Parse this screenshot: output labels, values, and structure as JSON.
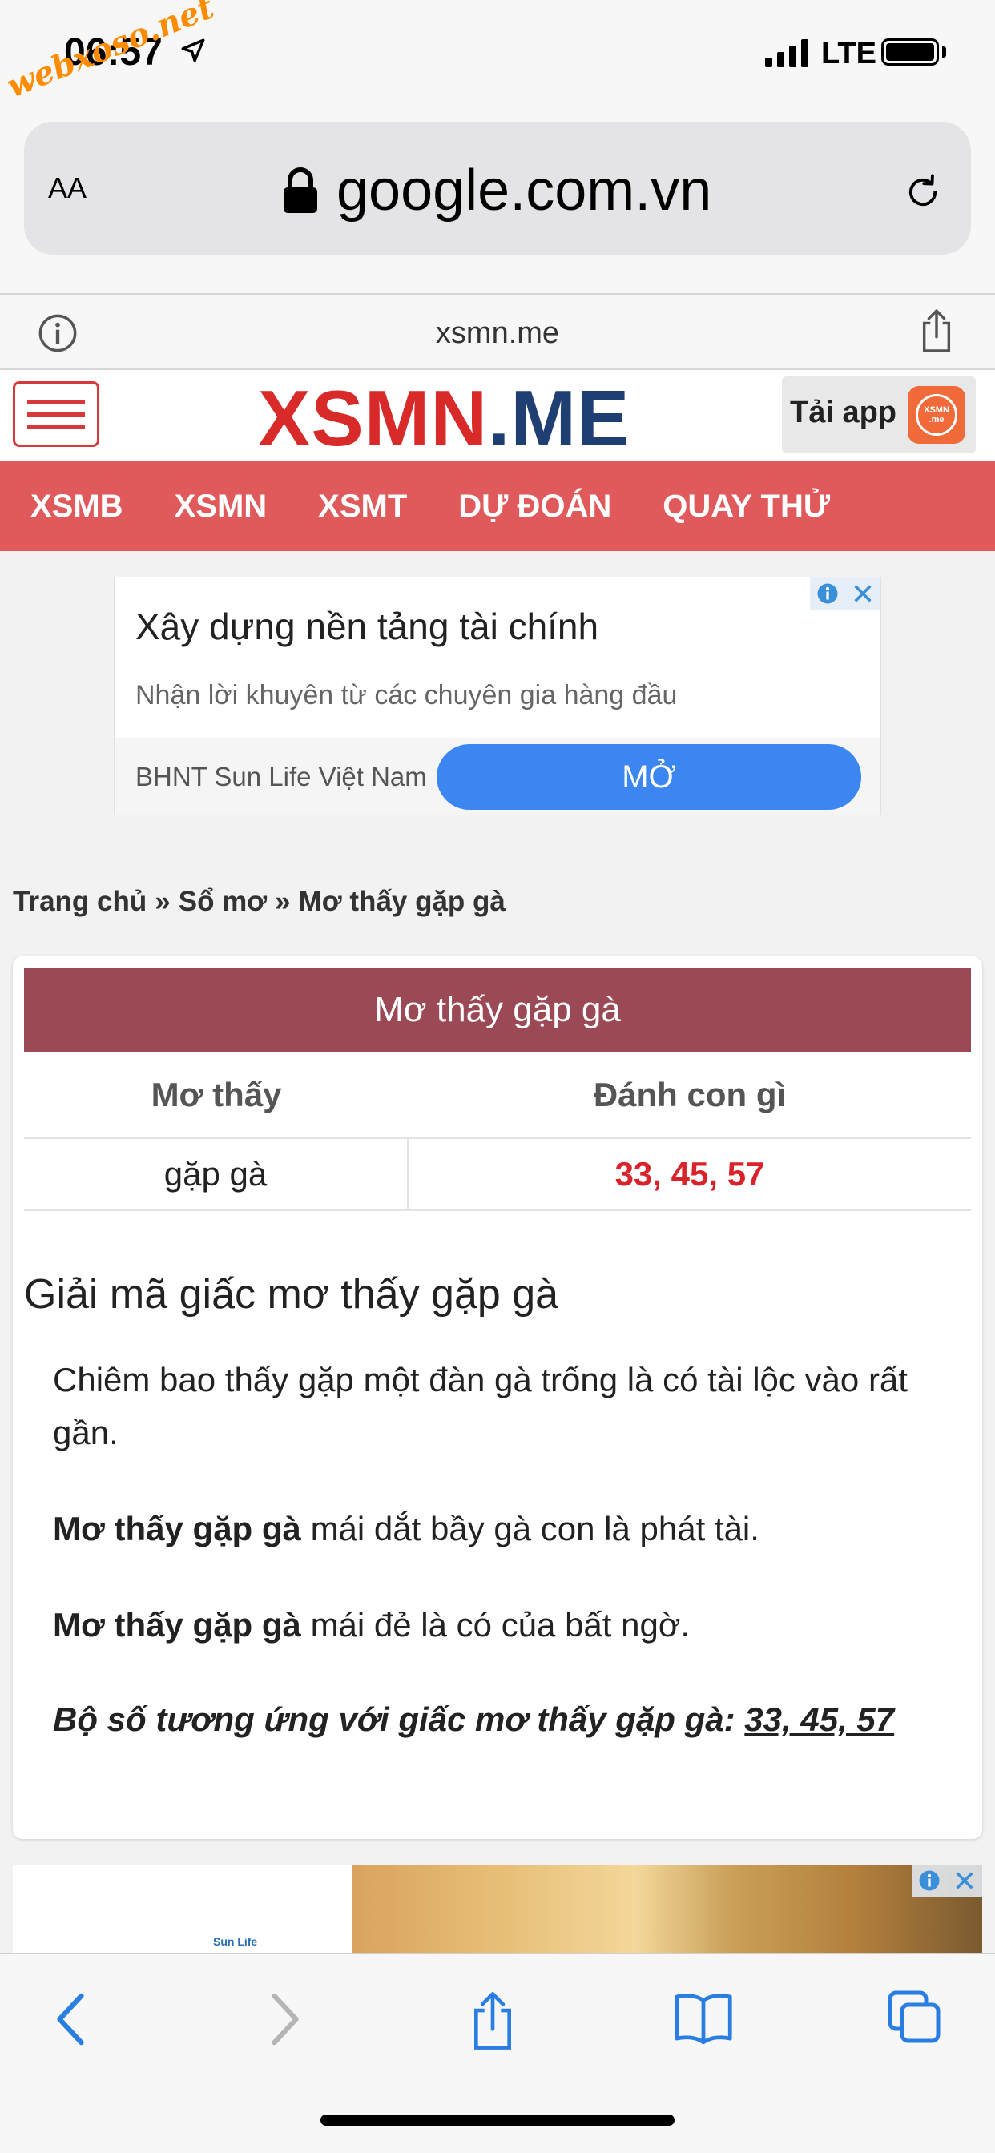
{
  "watermark": "webxoso.net",
  "status_bar": {
    "time": "06:57",
    "network": "LTE"
  },
  "browser": {
    "text_size_button": "AA",
    "address": "google.com.vn",
    "site_host": "xsmn.me"
  },
  "site": {
    "logo_red": "XSMN",
    "logo_blue": ".ME",
    "app_button": "Tải app",
    "app_icon_text": "XSMN .me",
    "nav": [
      "XSMB",
      "XSMN",
      "XSMT",
      "DỰ ĐOÁN",
      "QUAY THỬ"
    ]
  },
  "ad1": {
    "title": "Xây dựng nền tảng tài chính",
    "description": "Nhận lời khuyên từ các chuyên gia hàng đầu",
    "brand": "BHNT Sun Life Việt Nam",
    "cta": "MỞ"
  },
  "breadcrumb": {
    "items": [
      "Trang chủ",
      "Sổ mơ",
      "Mơ thấy gặp gà"
    ],
    "separator": "»"
  },
  "table": {
    "title": "Mơ thấy gặp gà",
    "headers": [
      "Mơ thấy",
      "Đánh con gì"
    ],
    "row": [
      "gặp gà",
      "33, 45, 57"
    ]
  },
  "article": {
    "heading": "Giải mã giấc mơ thấy gặp gà",
    "p1": "Chiêm bao thấy gặp một đàn gà trống là có tài lộc vào rất gần.",
    "p2_bold": "Mơ thấy gặp gà",
    "p2_rest": " mái dắt bầy gà con là phát tài.",
    "p3_bold": "Mơ thấy gặp gà",
    "p3_rest": " mái đẻ là có của bất ngờ.",
    "p4_prefix": "Bộ số tương ứng với giấc mơ thấy gặp gà: ",
    "p4_numbers": "33, 45, 57"
  },
  "ad2": {
    "logo": "Sun Life"
  },
  "colors": {
    "nav_bg": "#e05a5b",
    "table_header_bg": "#9b4a55",
    "number_red": "#d9232a",
    "cta_blue": "#3b86f0"
  }
}
